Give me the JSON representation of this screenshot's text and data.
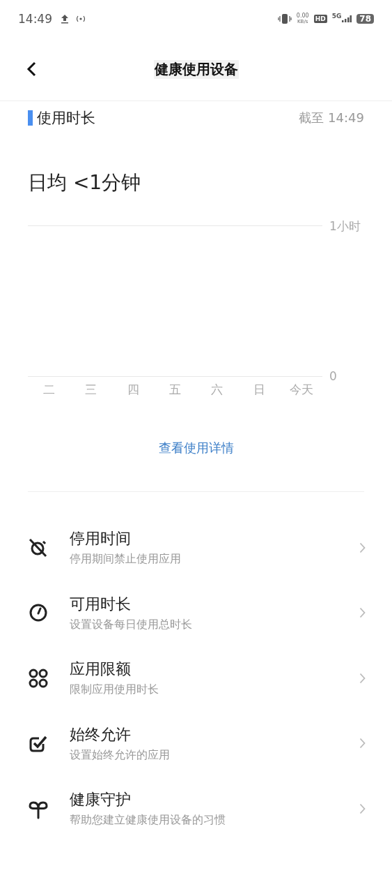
{
  "status_bar": {
    "time": "14:49",
    "speed_value": "0.00",
    "speed_unit": "KB/s",
    "hd": "HD",
    "network": "5G",
    "battery": "78"
  },
  "header": {
    "title": "健康使用设备"
  },
  "usage": {
    "title": "使用时长",
    "as_of": "截至 14:49",
    "daily_average": "日均 <1分钟",
    "chart_data": {
      "type": "bar",
      "categories": [
        "二",
        "三",
        "四",
        "五",
        "六",
        "日",
        "今天"
      ],
      "values": [
        null,
        null,
        null,
        null,
        null,
        null,
        null
      ],
      "ylim": [
        0,
        1
      ],
      "yticks": [
        0,
        {
          "value": 1,
          "label": "1小时"
        }
      ]
    },
    "details_link": "查看使用详情"
  },
  "items": [
    {
      "kind": "downtime",
      "title": "停用时间",
      "subtitle": "停用期间禁止使用应用"
    },
    {
      "kind": "limit",
      "title": "可用时长",
      "subtitle": "设置设备每日使用总时长"
    },
    {
      "kind": "apps",
      "title": "应用限额",
      "subtitle": "限制应用使用时长"
    },
    {
      "kind": "allow",
      "title": "始终允许",
      "subtitle": "设置始终允许的应用"
    },
    {
      "kind": "guard",
      "title": "健康守护",
      "subtitle": "帮助您建立健康使用设备的习惯"
    }
  ]
}
